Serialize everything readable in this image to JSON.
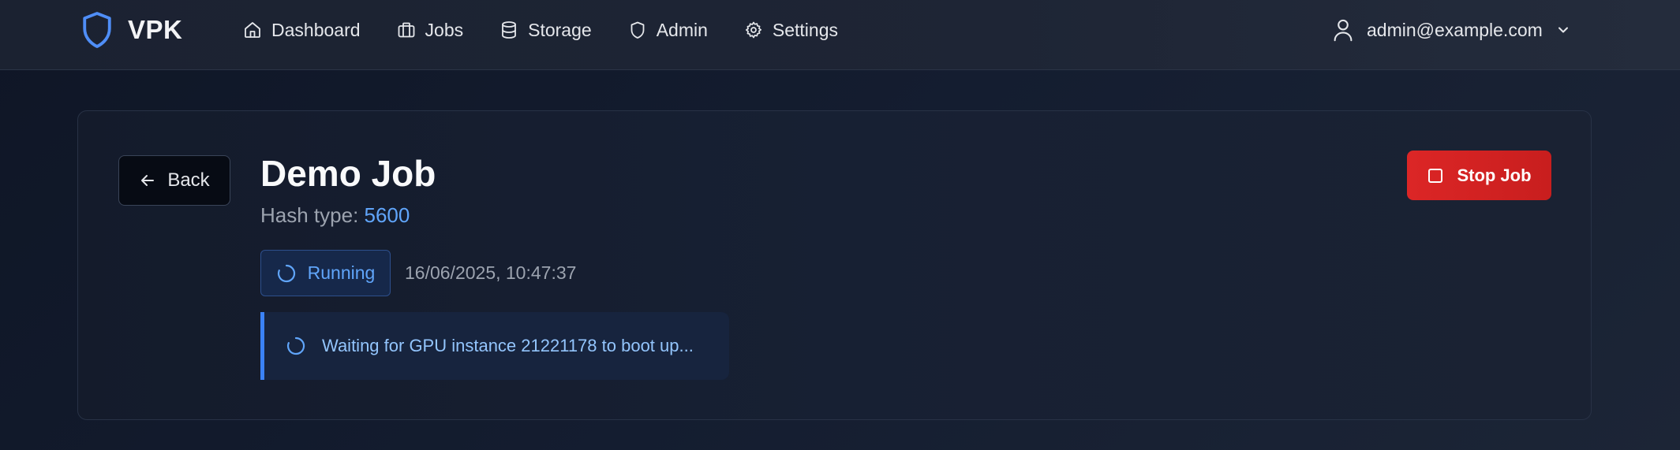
{
  "brand": {
    "name": "VPK",
    "icon": "shield-icon"
  },
  "nav": {
    "items": [
      {
        "label": "Dashboard",
        "icon": "home-icon"
      },
      {
        "label": "Jobs",
        "icon": "briefcase-icon"
      },
      {
        "label": "Storage",
        "icon": "database-icon"
      },
      {
        "label": "Admin",
        "icon": "shield-icon"
      },
      {
        "label": "Settings",
        "icon": "gear-icon"
      }
    ]
  },
  "user": {
    "email": "admin@example.com",
    "icon": "user-icon"
  },
  "job": {
    "back_label": "Back",
    "title": "Demo Job",
    "hash_label": "Hash type: ",
    "hash_value": "5600",
    "status": "Running",
    "timestamp": "16/06/2025, 10:47:37",
    "info_message": "Waiting for GPU instance 21221178 to boot up...",
    "stop_label": "Stop Job"
  },
  "colors": {
    "accent": "#3b82f6",
    "accent_text": "#60a5fa",
    "danger": "#dc2626",
    "background": "#141b2b"
  }
}
